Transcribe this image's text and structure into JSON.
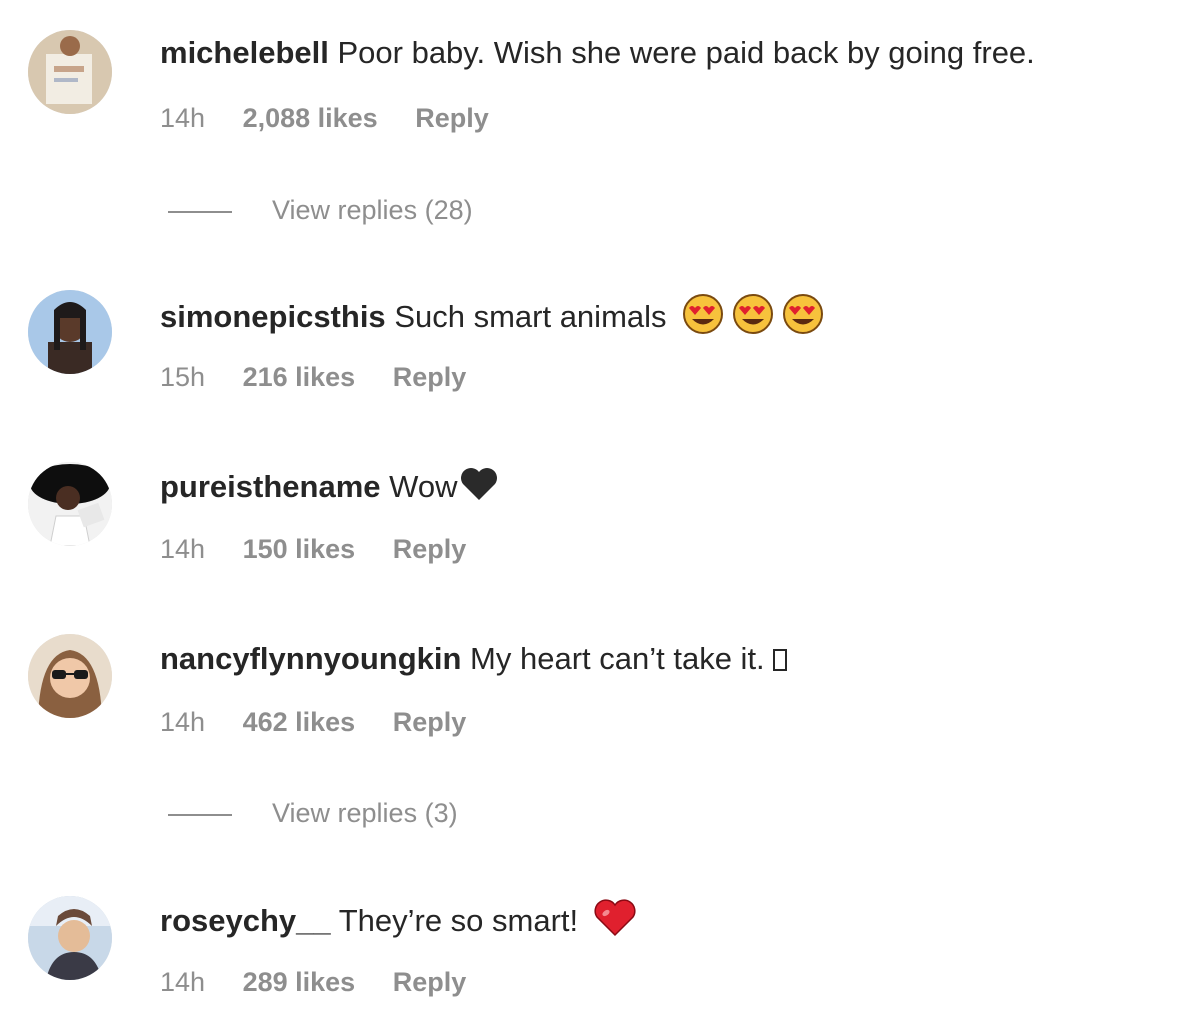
{
  "comments": [
    {
      "username": "michelebell",
      "text": "Poor baby. Wish she were paid back by going free.",
      "time": "14h",
      "likes": "2,088 likes",
      "reply": "Reply",
      "view_replies": "View replies (28)",
      "avatar_icon": "avatar-photo"
    },
    {
      "username": "simonepicsthis",
      "text": "Such smart animals",
      "emoji": "heart-eyes-emoji x3",
      "time": "15h",
      "likes": "216 likes",
      "reply": "Reply",
      "avatar_icon": "avatar-photo"
    },
    {
      "username": "pureisthename",
      "text": "Wow",
      "emoji": "black-heart-emoji",
      "time": "14h",
      "likes": "150 likes",
      "reply": "Reply",
      "avatar_icon": "avatar-photo"
    },
    {
      "username": "nancyflynnyoungkin",
      "text": "My heart can’t take it.",
      "emoji": "missing-glyph-box",
      "time": "14h",
      "likes": "462 likes",
      "reply": "Reply",
      "view_replies": "View replies (3)",
      "avatar_icon": "avatar-photo"
    },
    {
      "username": "roseychy__",
      "text": "They’re so smart!",
      "emoji": "red-heart-emoji",
      "time": "14h",
      "likes": "289 likes",
      "reply": "Reply",
      "avatar_icon": "avatar-photo"
    }
  ],
  "colors": {
    "text": "#262626",
    "meta": "#8e8e8e",
    "heart_red": "#e0202e",
    "emoji_yellow": "#f7c23c"
  }
}
